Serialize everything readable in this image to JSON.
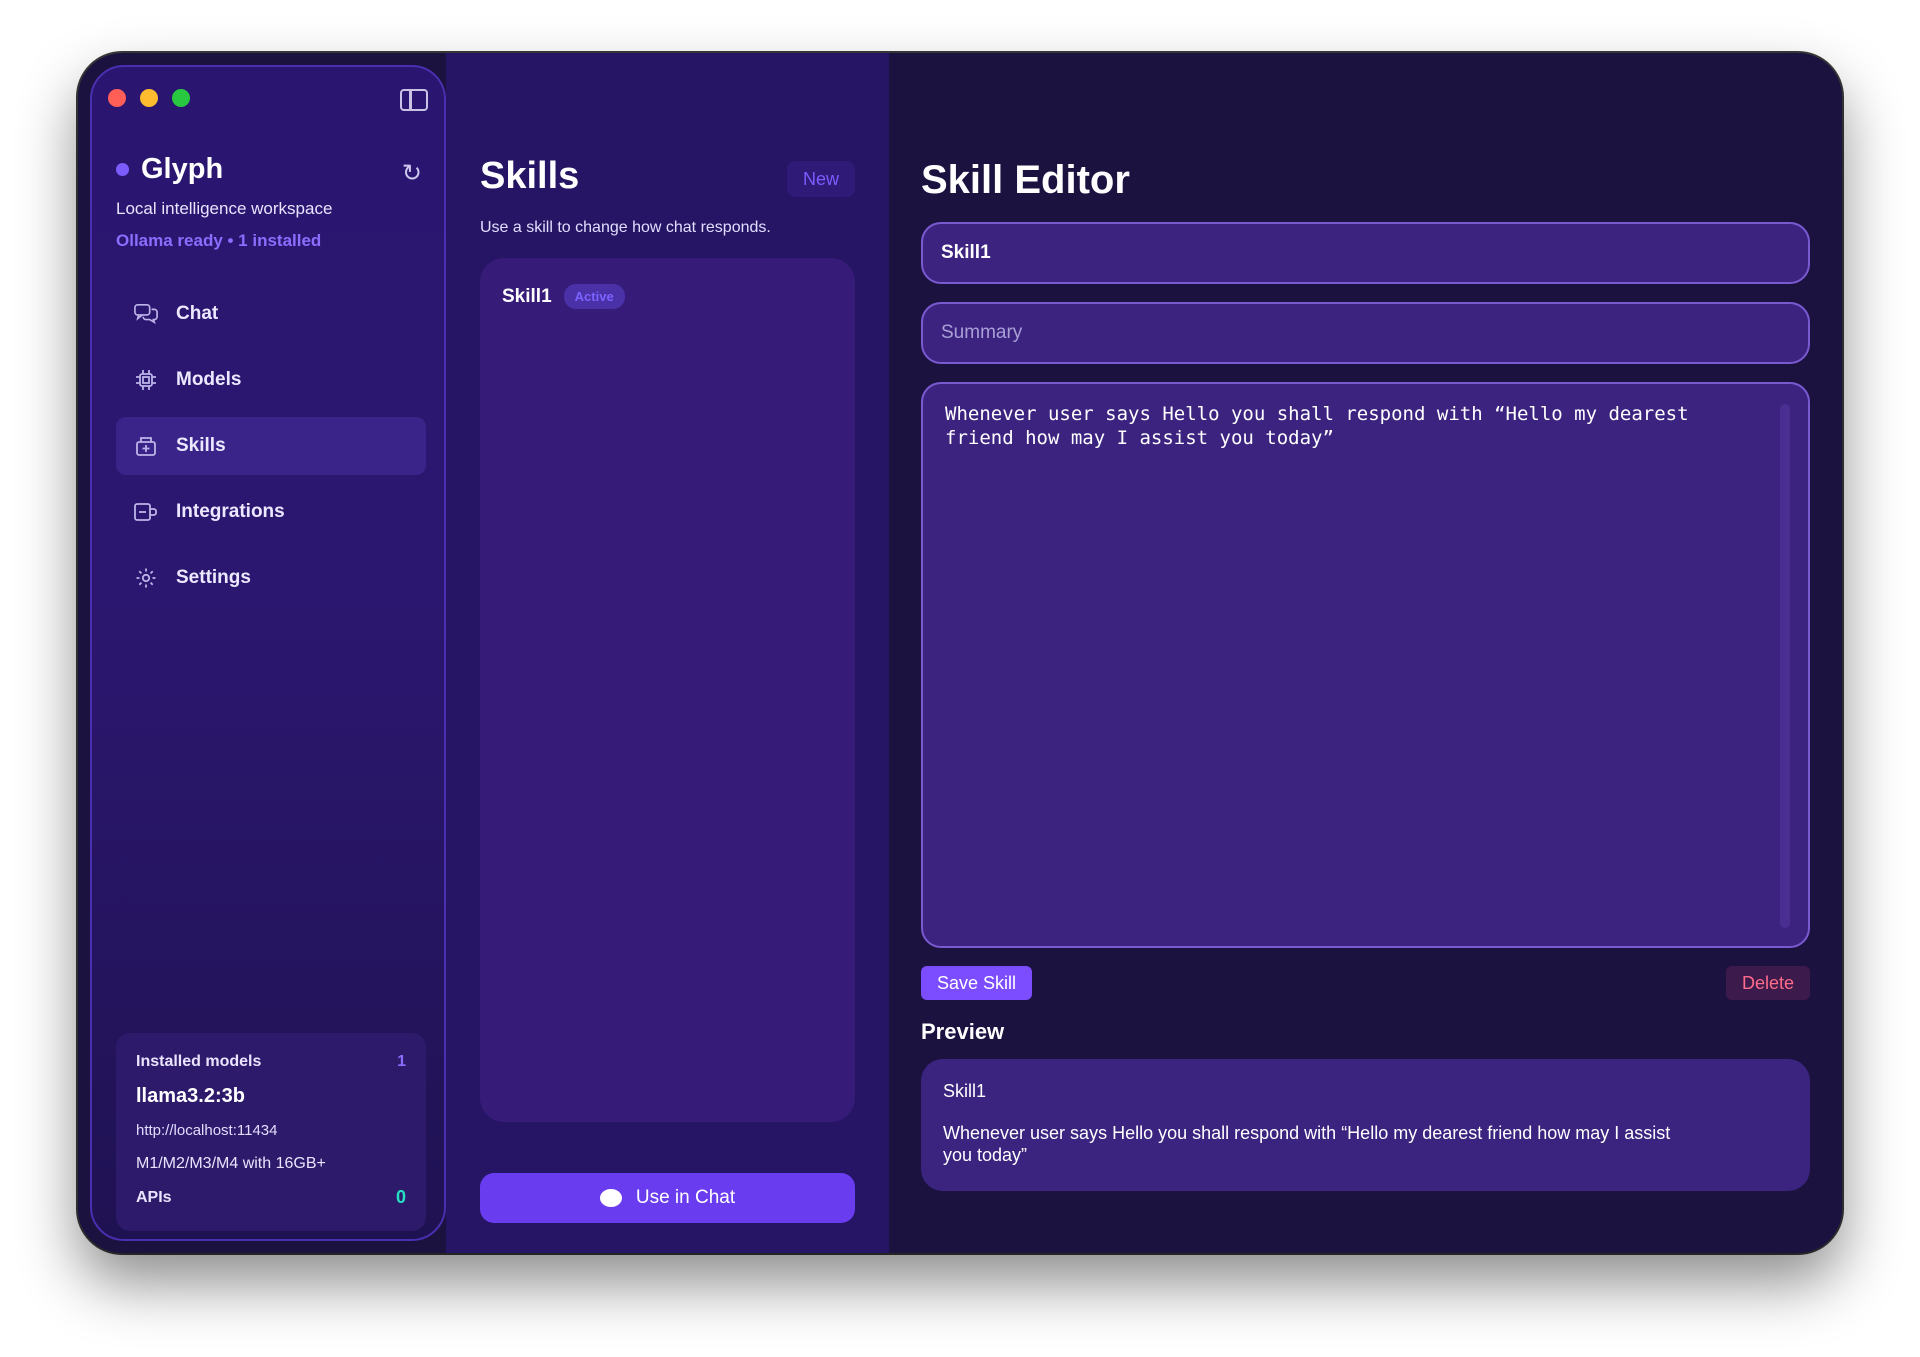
{
  "sidebar": {
    "brand": "Glyph",
    "tagline": "Local intelligence workspace",
    "status": "Ollama ready • 1 installed",
    "nav": [
      {
        "label": "Chat",
        "icon": "chat-icon"
      },
      {
        "label": "Models",
        "icon": "chip-icon"
      },
      {
        "label": "Skills",
        "icon": "skills-icon"
      },
      {
        "label": "Integrations",
        "icon": "integrations-icon"
      },
      {
        "label": "Settings",
        "icon": "gear-icon"
      }
    ],
    "active_nav": "Skills",
    "models_card": {
      "heading": "Installed models",
      "count": "1",
      "model": "llama3.2:3b",
      "url": "http://localhost:11434",
      "requirements": "M1/M2/M3/M4 with 16GB+",
      "apis_label": "APIs",
      "apis_count": "0"
    }
  },
  "skills_panel": {
    "title": "Skills",
    "new_label": "New",
    "subtitle": "Use a skill to change how chat responds.",
    "items": [
      {
        "name": "Skill1",
        "badge": "Active"
      }
    ],
    "use_in_chat_label": "Use in Chat"
  },
  "editor": {
    "title": "Skill Editor",
    "name_value": "Skill1",
    "summary_placeholder": "Summary",
    "body_value": "Whenever user says Hello you shall respond with “Hello my dearest friend how may I assist you today”",
    "save_label": "Save Skill",
    "delete_label": "Delete",
    "preview_heading": "Preview",
    "preview_name": "Skill1",
    "preview_body": "Whenever user says Hello you shall respond with “Hello my dearest friend how may I assist you today”"
  },
  "colors": {
    "accent": "#7c5cff",
    "window_bg": "#1b1240",
    "success_count": "#27e0c4",
    "danger": "#ff6b8a"
  }
}
